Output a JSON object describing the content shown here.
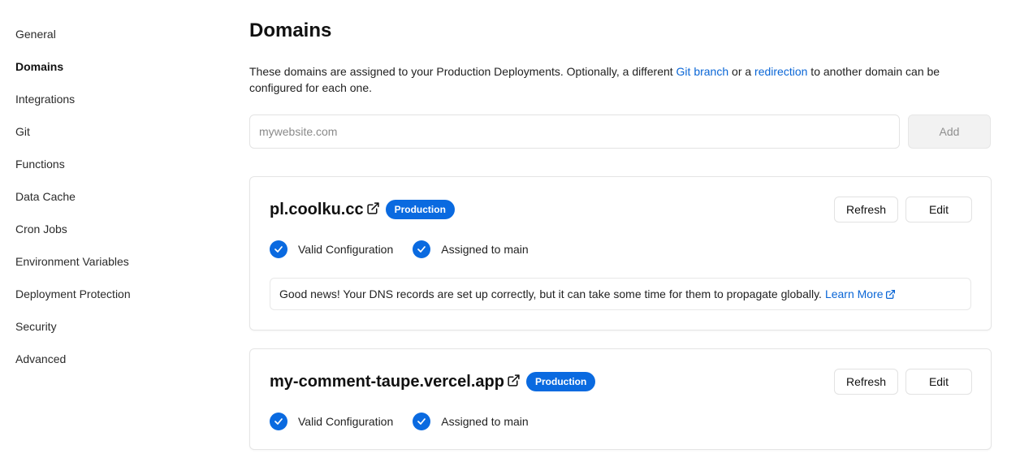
{
  "sidebar": {
    "items": [
      {
        "label": "General"
      },
      {
        "label": "Domains",
        "active": true
      },
      {
        "label": "Integrations"
      },
      {
        "label": "Git"
      },
      {
        "label": "Functions"
      },
      {
        "label": "Data Cache"
      },
      {
        "label": "Cron Jobs"
      },
      {
        "label": "Environment Variables"
      },
      {
        "label": "Deployment Protection"
      },
      {
        "label": "Security"
      },
      {
        "label": "Advanced"
      }
    ]
  },
  "main": {
    "title": "Domains",
    "description": {
      "part1": "These domains are assigned to your Production Deployments. Optionally, a different ",
      "link1": "Git branch",
      "part2": " or a ",
      "link2": "redirection",
      "part3": " to another domain can be configured for each one."
    },
    "input": {
      "placeholder": "mywebsite.com",
      "value": ""
    },
    "add_label": "Add"
  },
  "domains": [
    {
      "name": "pl.coolku.cc",
      "badge": "Production",
      "refresh_label": "Refresh",
      "edit_label": "Edit",
      "status_config": "Valid Configuration",
      "status_assigned": "Assigned to main",
      "note": {
        "text": "Good news! Your DNS records are set up correctly, but it can take some time for them to propagate globally.",
        "link": "Learn More"
      }
    },
    {
      "name": "my-comment-taupe.vercel.app",
      "badge": "Production",
      "refresh_label": "Refresh",
      "edit_label": "Edit",
      "status_config": "Valid Configuration",
      "status_assigned": "Assigned to main"
    }
  ],
  "colors": {
    "accent": "#0a6ae0",
    "link": "#0a66d6"
  },
  "icons": {
    "external_link": "external-link-icon",
    "check": "check-circle-icon"
  }
}
